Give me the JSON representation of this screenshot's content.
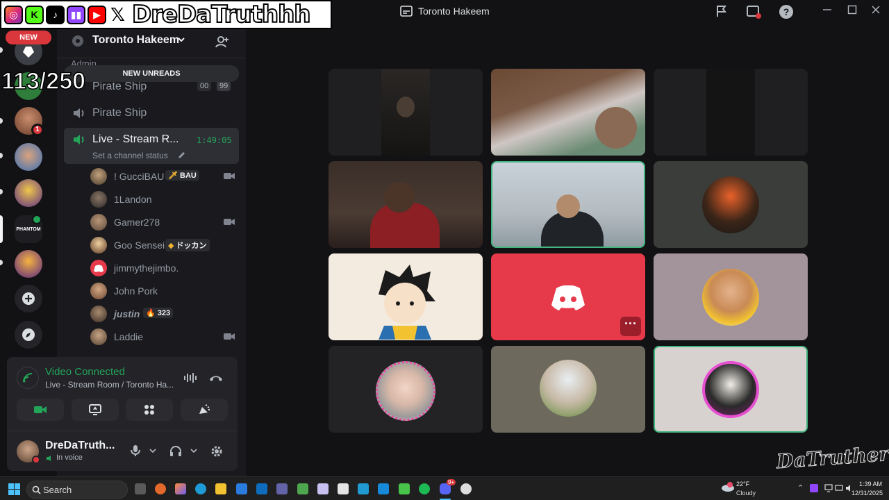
{
  "window": {
    "title": "Toronto Hakeem"
  },
  "overlay": {
    "handle": "DreDaTruthhh",
    "counter": "113/250",
    "watermark": "DaTruthers"
  },
  "rail": {
    "new_badge": "NEW",
    "mention_count": "1"
  },
  "server": {
    "name": "Toronto Hakeem",
    "category": "Admin",
    "new_unreads": "NEW UNREADS"
  },
  "channels": [
    {
      "name": "Pirate Ship",
      "badge_a": "00",
      "badge_b": "99"
    },
    {
      "name": "Pirate Ship"
    },
    {
      "name": "Live - Stream R...",
      "timer": "1:49:05",
      "status": "Set a channel status"
    }
  ],
  "members": [
    {
      "name": "! GucciBAU",
      "tag": "BAU",
      "tag_icon": "sword",
      "camera": true
    },
    {
      "name": "1Landon",
      "camera": false
    },
    {
      "name": "Gamer278",
      "camera": true
    },
    {
      "name": "Goo Sensei",
      "tag": "ドッカン",
      "tag_icon": "gem",
      "camera": false
    },
    {
      "name": "jimmythejimbo.",
      "camera": false
    },
    {
      "name": "John Pork",
      "camera": false
    },
    {
      "name": "justin",
      "tag": "323",
      "tag_icon": "flame",
      "camera": false
    },
    {
      "name": "Laddie",
      "camera": true
    }
  ],
  "voice": {
    "status": "Video Connected",
    "location": "Live - Stream Room / Toronto Ha..."
  },
  "user": {
    "name": "DreDaTruth...",
    "status": "In voice"
  },
  "taskbar": {
    "search": "Search",
    "weather_temp": "22°F",
    "weather_desc": "Cloudy",
    "time": "1:39 AM",
    "date": "12/31/2025",
    "discord_badge": "9+"
  },
  "colors": {
    "accent_green": "#23a559",
    "discord_red": "#e6394a",
    "blurple": "#5865f2"
  }
}
